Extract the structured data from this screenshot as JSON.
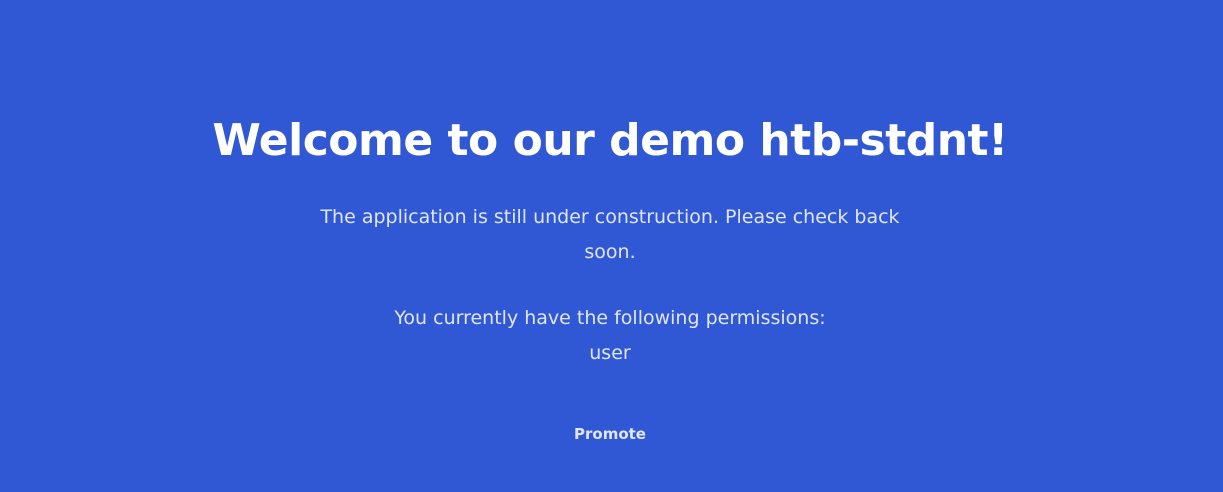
{
  "main": {
    "title": "Welcome to our demo htb-stdnt!",
    "description": "The application is still under construction. Please check back soon.",
    "permissions_label": "You currently have the following permissions:",
    "permissions_value": "user",
    "promote_label": "Promote"
  },
  "colors": {
    "background": "#3158d4",
    "title": "#ffffff",
    "text": "#dfe6fb"
  }
}
